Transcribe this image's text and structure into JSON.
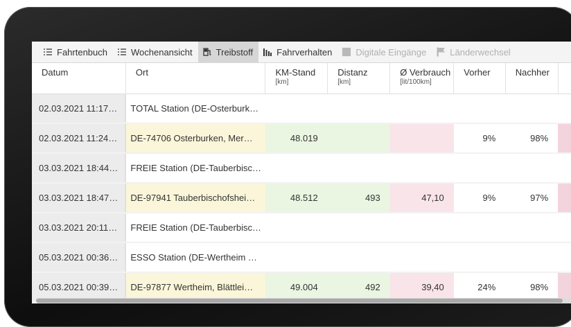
{
  "toolbar": [
    {
      "label": "Fahrtenbuch",
      "icon": "list-icon",
      "state": "normal"
    },
    {
      "label": "Wochenansicht",
      "icon": "list-icon",
      "state": "normal"
    },
    {
      "label": "Treibstoff",
      "icon": "fuel-pump-icon",
      "state": "active"
    },
    {
      "label": "Fahrverhalten",
      "icon": "bar-chart-icon",
      "state": "normal"
    },
    {
      "label": "Digitale Eingänge",
      "icon": "input-arrow-icon",
      "state": "disabled"
    },
    {
      "label": "Länderwechsel",
      "icon": "flag-icon",
      "state": "disabled"
    }
  ],
  "columns": [
    {
      "label": "Datum",
      "unit": ""
    },
    {
      "label": "Ort",
      "unit": ""
    },
    {
      "label": "KM-Stand",
      "unit": "[km]"
    },
    {
      "label": "Distanz",
      "unit": "[km]"
    },
    {
      "label": "Ø Verbrauch",
      "unit": "[lit/100km]"
    },
    {
      "label": "Vorher",
      "unit": ""
    },
    {
      "label": "Nachher",
      "unit": ""
    }
  ],
  "rows": [
    {
      "datum": "02.03.2021 11:17…",
      "ort": "TOTAL Station (DE-Osterburk…",
      "km": "",
      "distanz": "",
      "verbrauch": "",
      "vorher": "",
      "nachher": "",
      "fuel": false
    },
    {
      "datum": "02.03.2021 11:24…",
      "ort": "DE-74706 Osterburken, Mer…",
      "km": "48.019",
      "distanz": "",
      "verbrauch": "",
      "vorher": "9%",
      "nachher": "98%",
      "fuel": true
    },
    {
      "datum": "03.03.2021 18:44…",
      "ort": "FREIE Station (DE-Tauberbisc…",
      "km": "",
      "distanz": "",
      "verbrauch": "",
      "vorher": "",
      "nachher": "",
      "fuel": false
    },
    {
      "datum": "03.03.2021 18:47…",
      "ort": "DE-97941 Tauberbischofshei…",
      "km": "48.512",
      "distanz": "493",
      "verbrauch": "47,10",
      "vorher": "9%",
      "nachher": "97%",
      "fuel": true
    },
    {
      "datum": "03.03.2021 20:11…",
      "ort": "FREIE Station (DE-Tauberbisc…",
      "km": "",
      "distanz": "",
      "verbrauch": "",
      "vorher": "",
      "nachher": "",
      "fuel": false
    },
    {
      "datum": "05.03.2021 00:36…",
      "ort": "ESSO Station (DE-Wertheim …",
      "km": "",
      "distanz": "",
      "verbrauch": "",
      "vorher": "",
      "nachher": "",
      "fuel": false
    },
    {
      "datum": "05.03.2021 00:39…",
      "ort": "DE-97877 Wertheim, Blättlei…",
      "km": "49.004",
      "distanz": "492",
      "verbrauch": "39,40",
      "vorher": "24%",
      "nachher": "98%",
      "fuel": true
    }
  ]
}
